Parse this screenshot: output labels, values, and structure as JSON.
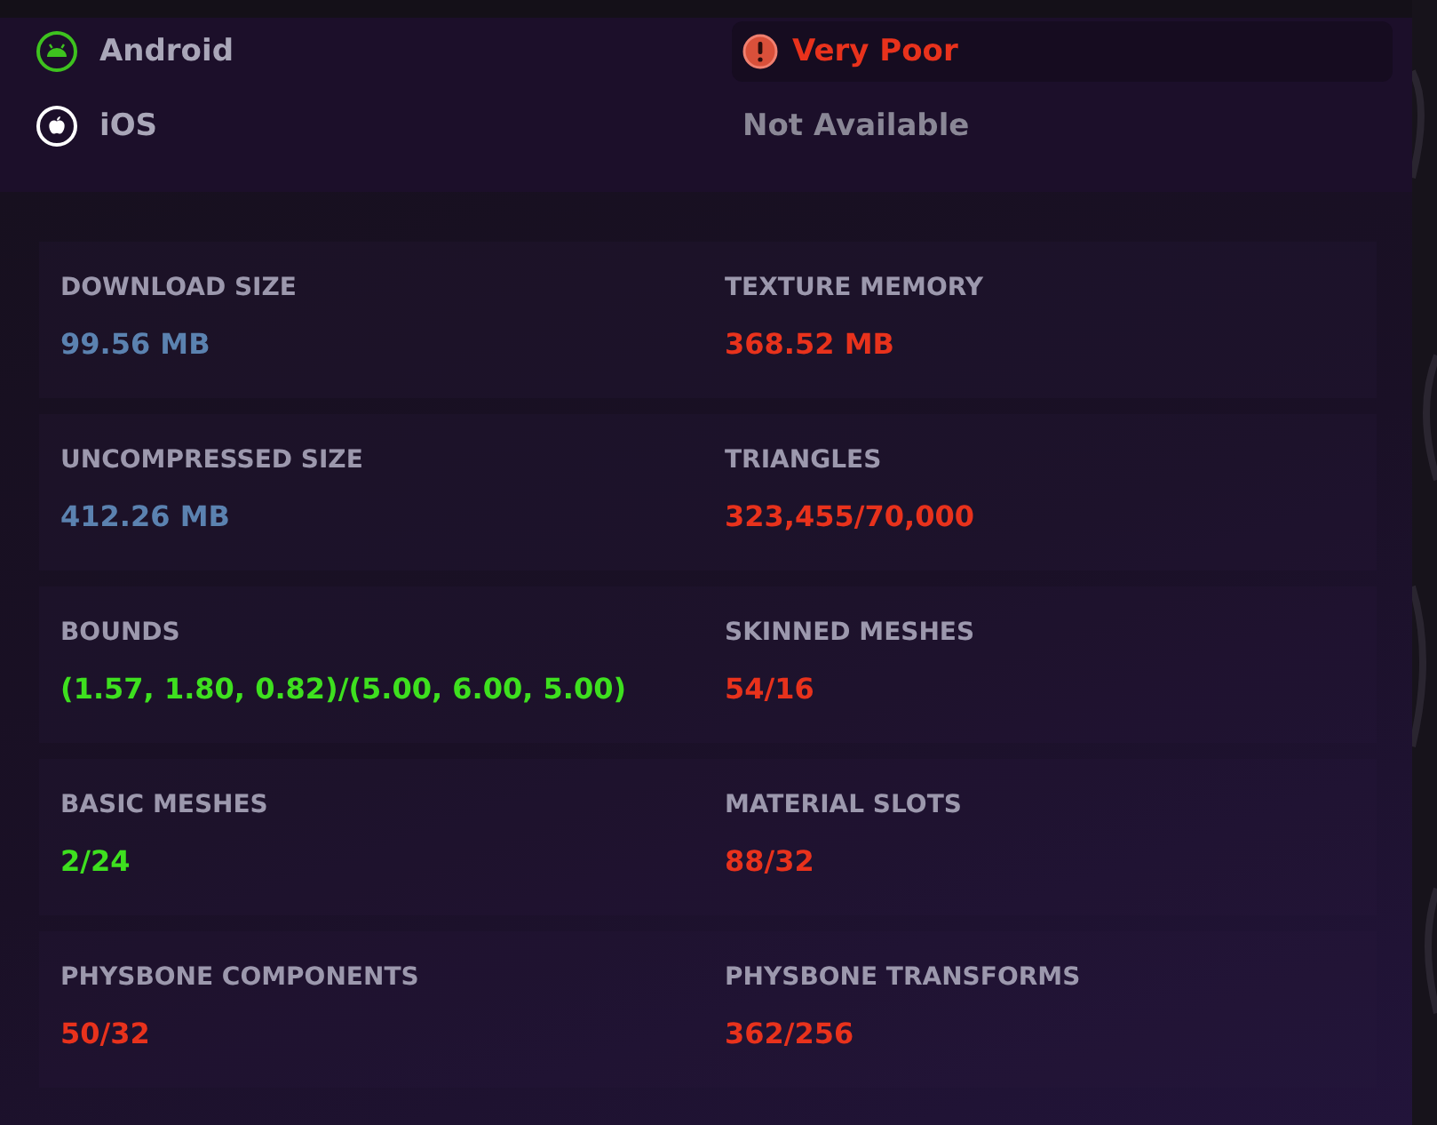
{
  "platforms": [
    {
      "kind": "android",
      "name": "Android",
      "status": {
        "kind": "rated",
        "text": "Very Poor"
      }
    },
    {
      "kind": "apple",
      "name": "iOS",
      "status": {
        "kind": "unavailable",
        "text": "Not Available"
      }
    }
  ],
  "stats": [
    {
      "label": "DOWNLOAD SIZE",
      "value": "99.56 MB",
      "color": "#5b82b0"
    },
    {
      "label": "TEXTURE MEMORY",
      "value": "368.52 MB",
      "color": "#e8321c"
    },
    {
      "label": "UNCOMPRESSED SIZE",
      "value": "412.26 MB",
      "color": "#5b82b0"
    },
    {
      "label": "TRIANGLES",
      "value": "323,455/70,000",
      "color": "#e8321c"
    },
    {
      "label": "BOUNDS",
      "value": "(1.57, 1.80, 0.82)/(5.00, 6.00, 5.00)",
      "color": "#3ee01f"
    },
    {
      "label": "SKINNED MESHES",
      "value": "54/16",
      "color": "#e8321c"
    },
    {
      "label": "BASIC MESHES",
      "value": "2/24",
      "color": "#3ee01f"
    },
    {
      "label": "MATERIAL SLOTS",
      "value": "88/32",
      "color": "#e8321c"
    },
    {
      "label": "PHYSBONE COMPONENTS",
      "value": "50/32",
      "color": "#e8321c"
    },
    {
      "label": "PHYSBONE TRANSFORMS",
      "value": "362/256",
      "color": "#e8321c"
    }
  ]
}
